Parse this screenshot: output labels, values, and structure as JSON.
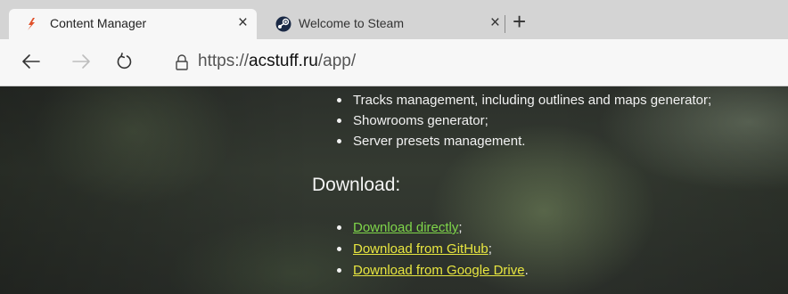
{
  "browser": {
    "tabs": [
      {
        "title": "Content Manager",
        "close": "×",
        "icon": "content-manager-logo-icon",
        "active": true
      },
      {
        "title": "Welcome to Steam",
        "close": "×",
        "icon": "steam-logo-icon",
        "active": false
      }
    ],
    "new_tab_label": "+",
    "url": {
      "scheme": "https://",
      "host": "acstuff.ru",
      "path": "/app/"
    }
  },
  "page": {
    "cut_top_text": "",
    "features": [
      "Tracks management, including outlines and maps generator;",
      "Showrooms generator;",
      "Server presets management."
    ],
    "download_heading": "Download:",
    "downloads": [
      {
        "link": "Download directly",
        "suffix": ";"
      },
      {
        "link": "Download from GitHub",
        "suffix": ";"
      },
      {
        "link": "Download from Google Drive",
        "suffix": "."
      }
    ]
  },
  "colors": {
    "link_direct": "#7fd64a",
    "link_other": "#e8e640",
    "tab_active": "#f7f7f7",
    "tab_strip": "#d4d4d4",
    "page_text": "#f2f2f2"
  }
}
